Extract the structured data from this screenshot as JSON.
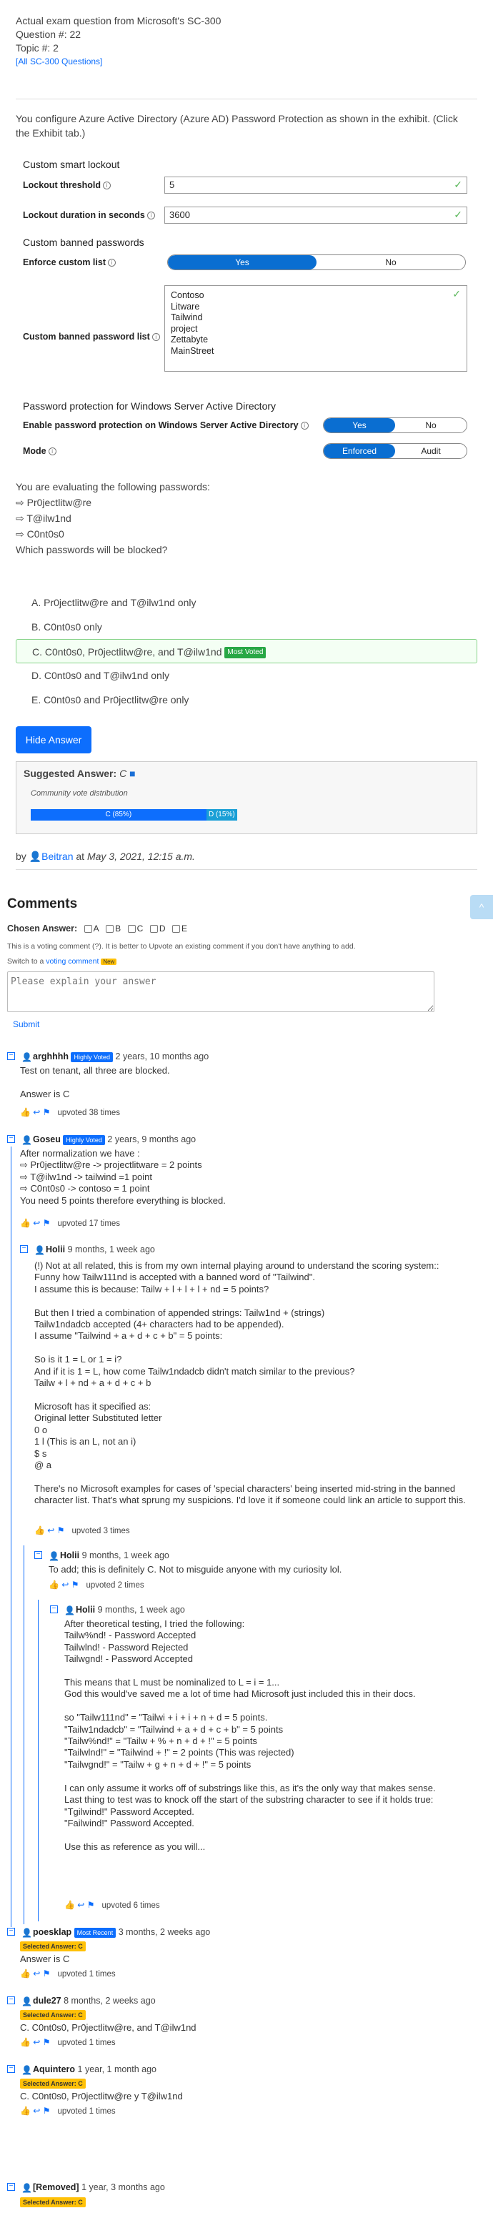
{
  "header": {
    "line1": "Actual exam question from Microsoft's SC-300",
    "line2": "Question #: 22",
    "line3": "Topic #: 2",
    "link": "[All SC-300 Questions]"
  },
  "question": {
    "text": "You configure Azure Active Directory (Azure AD) Password Protection as shown in the exhibit. (Click the Exhibit tab.)"
  },
  "exhibit": {
    "section1": "Custom smart lockout",
    "lockout_threshold_label": "Lockout threshold",
    "lockout_threshold_value": "5",
    "lockout_duration_label": "Lockout duration in seconds",
    "lockout_duration_value": "3600",
    "section2": "Custom banned passwords",
    "enforce_label": "Enforce custom list",
    "yes": "Yes",
    "no": "No",
    "banned_list_label": "Custom banned password list",
    "banned_list": [
      "Contoso",
      "Litware",
      "Tailwind",
      "project",
      "Zettabyte",
      "MainStreet"
    ],
    "section3": "Password protection for Windows Server Active Directory",
    "enable_label": "Enable password protection on Windows Server Active Directory",
    "mode_label": "Mode",
    "enforced": "Enforced",
    "audit": "Audit"
  },
  "prompt": {
    "intro": "You are evaluating the following passwords:",
    "p1": "⇨ Pr0jectlitw@re",
    "p2": "⇨ T@ilw1nd",
    "p3": "⇨ C0nt0s0",
    "ask": "Which passwords will be blocked?"
  },
  "options": [
    {
      "text": "A. Pr0jectlitw@re and T@ilw1nd only"
    },
    {
      "text": "B. C0nt0s0 only"
    },
    {
      "text": "C. C0nt0s0, Pr0jectlitw@re, and T@ilw1nd",
      "badge": "Most Voted"
    },
    {
      "text": "D. C0nt0s0 and T@ilw1nd only"
    },
    {
      "text": "E. C0nt0s0 and Pr0jectlitw@re only"
    }
  ],
  "hide_answer": "Hide Answer",
  "suggested": {
    "label": "Suggested Answer:",
    "answer": "C",
    "dist_label": "Community vote distribution",
    "c_label": "C (85%)",
    "d_label": "D (15%)",
    "c_pct": 85,
    "d_pct": 15
  },
  "byline": {
    "by": "by",
    "author": "Beitran",
    "at": "at",
    "date": "May 3, 2021, 12:15 a.m."
  },
  "comments_title": "Comments",
  "chosen": {
    "label": "Chosen Answer:",
    "options": [
      "A",
      "B",
      "C",
      "D",
      "E"
    ]
  },
  "notice": "This is a voting comment (?). It is better to Upvote an existing comment if you don't have anything to add.",
  "switch": {
    "pre": "Switch to a",
    "link": "voting comment",
    "badge": "New"
  },
  "textarea_placeholder": "Please explain your answer",
  "submit": "Submit",
  "comments": [
    {
      "user": "arghhhh",
      "badge": "Highly Voted",
      "time": "2 years, 10 months ago",
      "text": "Test on tenant, all three are blocked.\n\nAnswer is C",
      "votes": "upvoted 38 times"
    },
    {
      "user": "Goseu",
      "badge": "Highly Voted",
      "time": "2 years, 9 months ago",
      "text": "After normalization we have :\n⇨ Pr0jectlitw@re -> projectlitware = 2 points\n⇨ T@ilw1nd -> tailwind =1 point\n⇨ C0nt0s0 -> contoso = 1 point\nYou need 5 points therefore everything is blocked.",
      "votes": "upvoted 17 times"
    },
    {
      "user": "Holii",
      "time": "9 months, 1 week ago",
      "text": "(!) Not at all related, this is from my own internal playing around to understand the scoring system::\nFunny how Tailw111nd is accepted with a banned word of \"Tailwind\".\nI assume this is because: Tailw + l + l + l + nd = 5 points?\n\nBut then I tried a combination of appended strings: Tailw1nd + (strings)\nTailw1ndadcb accepted (4+ characters had to be appended).\nI assume \"Tailwind + a + d + c + b\" = 5 points:\n\nSo is it 1 = L or 1 = i?\nAnd if it is 1 = L, how come Tailw1ndadcb didn't match similar to the previous?\nTailw + l + nd + a + d + c + b\n\nMicrosoft has it specified as:\nOriginal letter Substituted letter\n0 o\n1 l (This is an L, not an i)\n$ s\n@ a\n\nThere's no Microsoft examples for cases of 'special characters' being inserted mid-string in the banned character list. That's what sprung my suspicions. I'd love it if someone could link an article to support this.",
      "votes": "upvoted 3 times"
    },
    {
      "user": "Holii",
      "time": "9 months, 1 week ago",
      "text": "To add; this is definitely C. Not to misguide anyone with my curiosity lol.",
      "votes": "upvoted 2 times"
    },
    {
      "user": "Holii",
      "time": "9 months, 1 week ago",
      "text": "After theoretical testing, I tried the following:\nTailw%nd! - Password Accepted\nTailwlnd! - Password Rejected\nTailwgnd! - Password Accepted\n\nThis means that L must be nominalized to L = i = 1...\nGod this would've saved me a lot of time had Microsoft just included this in their docs.\n\nso \"Tailw111nd\" = \"Tailwi + i + i + n + d = 5 points.\n\"Tailw1ndadcb\" = \"Tailwind + a + d + c + b\" = 5 points\n\"Tailw%nd!\" = \"Tailw + % + n + d + !\" = 5 points\n\"Tailwlnd!\" = \"Tailwind + !\" = 2 points (This was rejected)\n\"Tailwgnd!\" = \"Tailw + g + n + d + !\" = 5 points\n\nI can only assume it works off of substrings like this, as it's the only way that makes sense.\nLast thing to test was to knock off the start of the substring character to see if it holds true:\n\"Tgilwind!\" Password Accepted.\n\"Failwind!\" Password Accepted.\n\nUse this as reference as you will...",
      "votes": "upvoted 6 times"
    },
    {
      "user": "poesklap",
      "badge": "Most Recent",
      "time": "3 months, 2 weeks ago",
      "selected": "Selected Answer: C",
      "text": "Answer is C",
      "votes": "upvoted 1 times"
    },
    {
      "user": "dule27",
      "time": "8 months, 2 weeks ago",
      "selected": "Selected Answer: C",
      "text": "C. C0nt0s0, Pr0jectlitw@re, and T@ilw1nd",
      "votes": "upvoted 1 times"
    },
    {
      "user": "Aquintero",
      "time": "1 year, 1 month ago",
      "selected": "Selected Answer: C",
      "text": "C. C0nt0s0, Pr0jectlitw@re y T@ilw1nd",
      "votes": "upvoted 1 times"
    },
    {
      "user": "[Removed]",
      "time": "1 year, 3 months ago",
      "selected": "Selected Answer: C"
    }
  ]
}
